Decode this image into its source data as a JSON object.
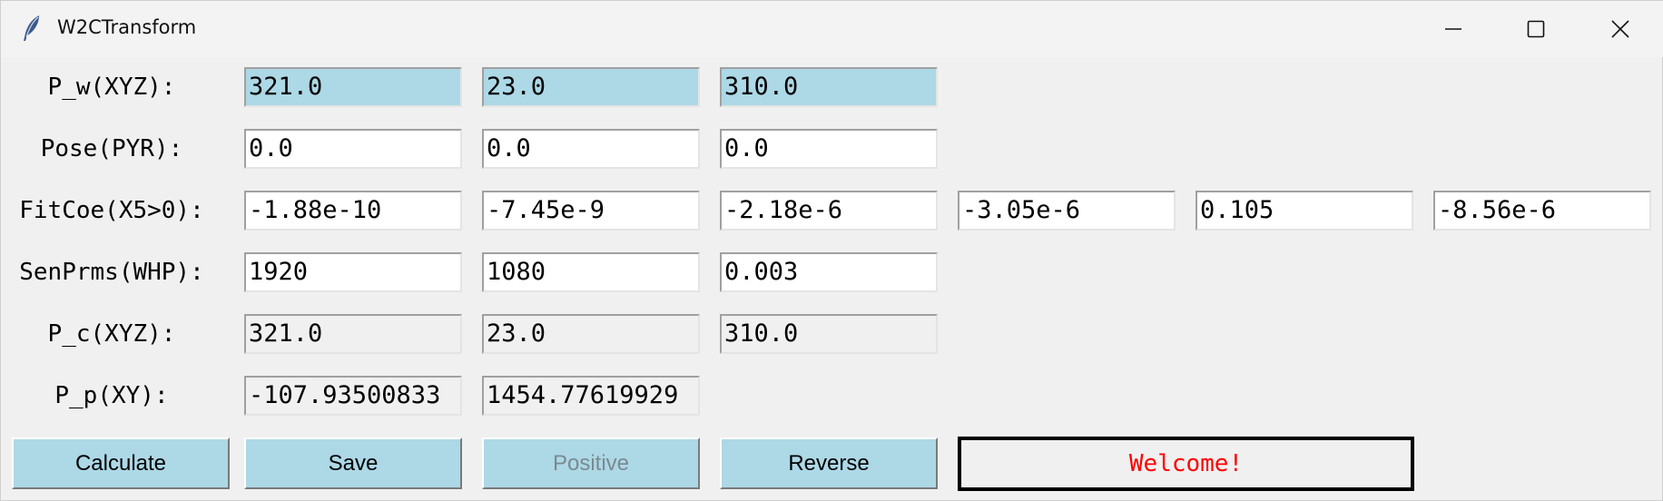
{
  "window": {
    "title": "W2CTransform",
    "minimize_icon": "minimize-icon",
    "maximize_icon": "maximize-icon",
    "close_icon": "close-icon",
    "app_icon": "feather-icon"
  },
  "rows": [
    {
      "label": "P_w(XYZ):",
      "values": [
        "321.0",
        "23.0",
        "310.0"
      ]
    },
    {
      "label": "Pose(PYR):",
      "values": [
        "0.0",
        "0.0",
        "0.0"
      ]
    },
    {
      "label": "FitCoe(X5>0):",
      "values": [
        "-1.88e-10",
        "-7.45e-9",
        "-2.18e-6",
        "-3.05e-6",
        "0.105",
        "-8.56e-6"
      ]
    },
    {
      "label": "SenPrms(WHP):",
      "values": [
        "1920",
        "1080",
        "0.003"
      ]
    },
    {
      "label": "P_c(XYZ):",
      "values": [
        "321.0",
        "23.0",
        "310.0"
      ]
    },
    {
      "label": "P_p(XY):",
      "values": [
        "-107.93500833",
        "1454.77619929"
      ]
    }
  ],
  "buttons": {
    "calculate": "Calculate",
    "save": "Save",
    "positive": "Positive",
    "reverse": "Reverse"
  },
  "status": {
    "message": "Welcome!"
  },
  "colors": {
    "accent": "#add8e6",
    "status_text": "#ff0000",
    "background": "#f0f0f0"
  }
}
